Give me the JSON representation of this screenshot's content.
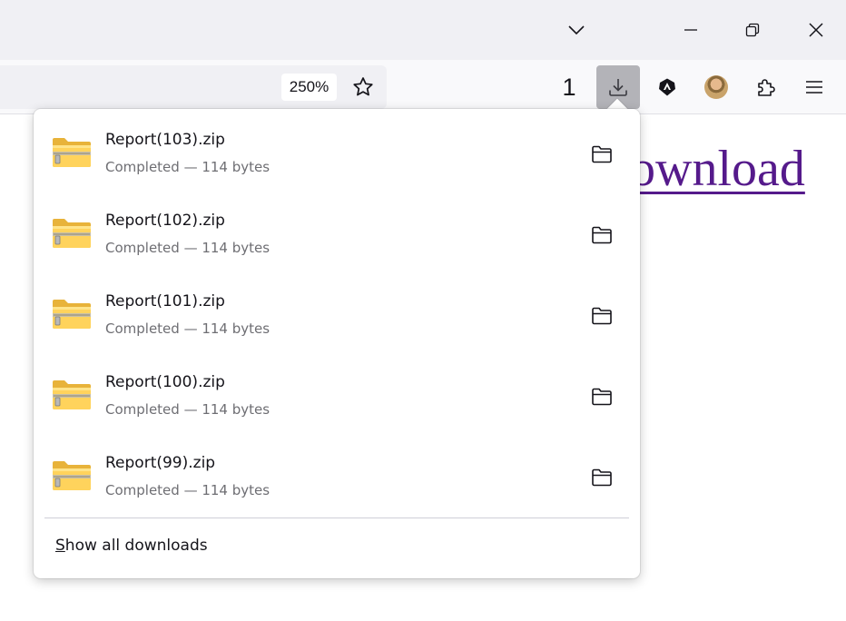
{
  "toolbar": {
    "zoom_level": "250%",
    "download_count": "1"
  },
  "page": {
    "link_text": "ownload"
  },
  "downloads_panel": {
    "items": [
      {
        "filename": "Report(103).zip",
        "status": "Completed — 114 bytes"
      },
      {
        "filename": "Report(102).zip",
        "status": "Completed — 114 bytes"
      },
      {
        "filename": "Report(101).zip",
        "status": "Completed — 114 bytes"
      },
      {
        "filename": "Report(100).zip",
        "status": "Completed — 114 bytes"
      },
      {
        "filename": "Report(99).zip",
        "status": "Completed — 114 bytes"
      }
    ],
    "show_all_access_key": "S",
    "show_all_rest": "how all downloads"
  },
  "icons": {
    "tab_list": "chevron-down-icon",
    "minimize": "minimize-icon",
    "restore": "restore-icon",
    "close": "close-icon",
    "bookmark": "star-icon",
    "downloads": "download-icon",
    "extension_a": "brave-lion-icon",
    "profile": "avatar",
    "extensions": "puzzle-icon",
    "menu": "hamburger-menu-icon",
    "file": "zip-folder-icon",
    "show_in_folder": "folder-icon"
  },
  "colors": {
    "link_visited": "#551a8b",
    "downloads_button_active": "#b3b3b8",
    "titlebar": "#f0f0f4"
  }
}
